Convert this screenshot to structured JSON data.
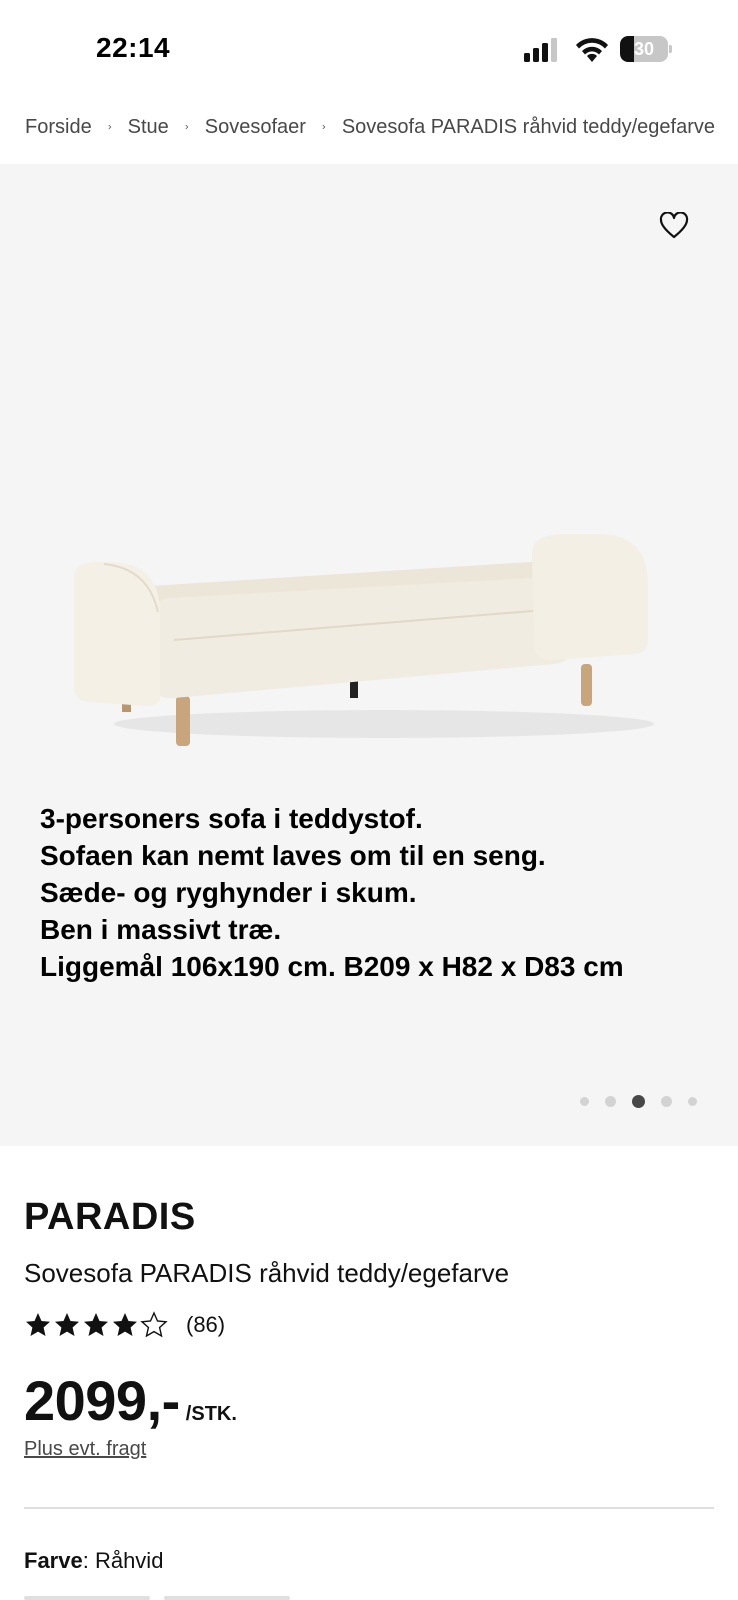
{
  "status_bar": {
    "time": "22:14",
    "battery_level": "30",
    "battery_fraction": 0.3,
    "icons": [
      "signal-icon",
      "wifi-icon",
      "battery-icon"
    ]
  },
  "breadcrumb": {
    "items": [
      "Forside",
      "Stue",
      "Sovesofaer",
      "Sovesofa PARADIS råhvid teddy/egefarve"
    ],
    "separator_icon": "chevron-right-icon"
  },
  "gallery": {
    "wishlist_icon": "heart-outline-icon",
    "caption_lines": [
      "3-personers sofa i teddystof.",
      "Sofaen kan nemt laves om til en seng.",
      "Sæde- og ryghynder i skum.",
      "Ben i massivt træ.",
      "Liggemål 106x190 cm. B209 x H82 x D83 cm"
    ],
    "image_count": 5,
    "active_index": 2,
    "background_color": "#f5f5f5"
  },
  "product": {
    "name": "PARADIS",
    "description": "Sovesofa PARADIS råhvid teddy/egefarve",
    "rating": 4.5,
    "rating_max": 5,
    "review_count": "(86)",
    "price": "2099,-",
    "price_unit": "/STK.",
    "shipping_note": "Plus evt. fragt",
    "color_label": "Farve",
    "color_value": "Råhvid"
  },
  "colors": {
    "text": "#111111",
    "muted": "#484848",
    "divider": "#dfdfdf"
  }
}
